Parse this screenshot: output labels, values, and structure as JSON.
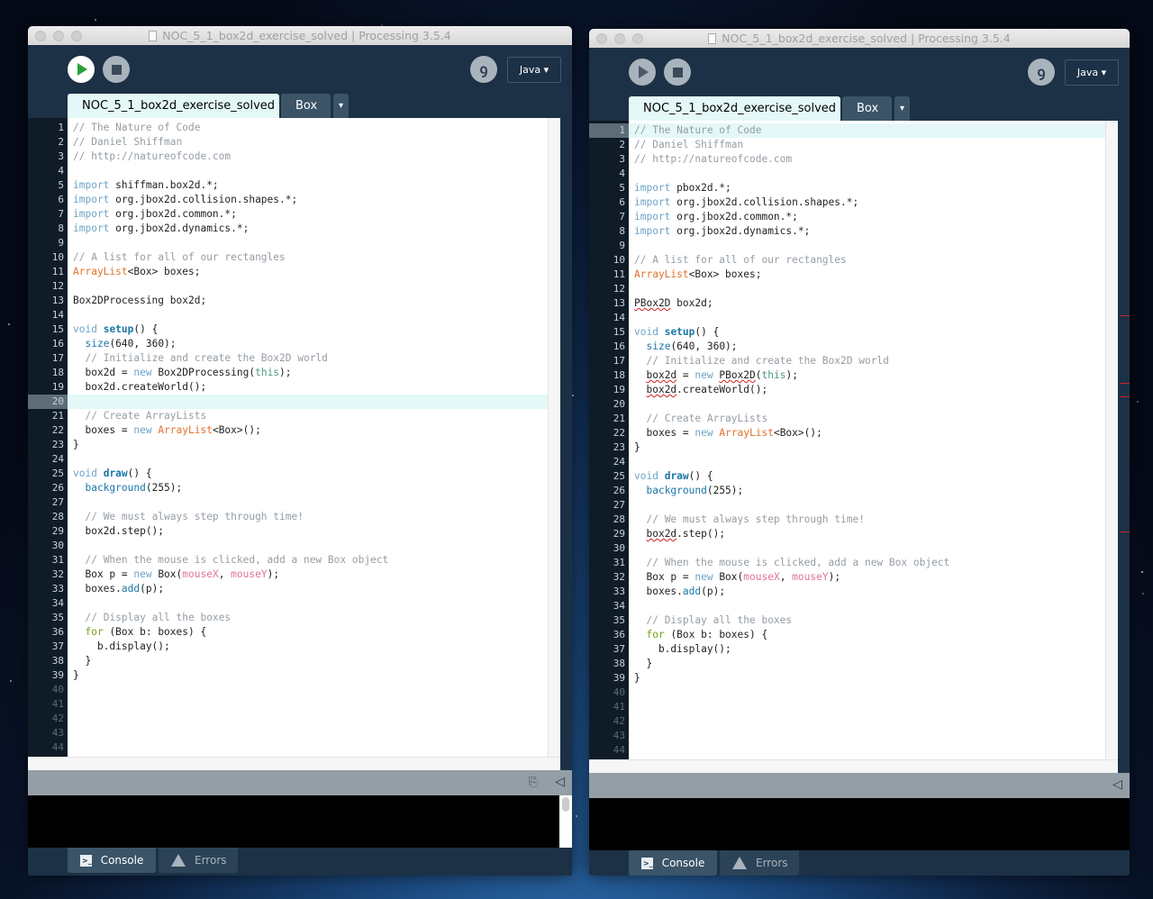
{
  "windows": [
    {
      "title": "NOC_5_1_box2d_exercise_solved | Processing 3.5.4",
      "mode": "Java ▾",
      "run_state": "active",
      "tabs": [
        {
          "label": "NOC_5_1_box2d_exercise_solved"
        },
        {
          "label": "Box"
        }
      ],
      "tab_menu": "▾",
      "highlight_line": 20,
      "console_tab": "Console",
      "errors_tab": "Errors",
      "collapse_icon": "◁",
      "copy_icon": "⎘",
      "code": [
        [
          [
            "c",
            "// The Nature of Code"
          ]
        ],
        [
          [
            "c",
            "// Daniel Shiffman"
          ]
        ],
        [
          [
            "c",
            "// http://natureofcode.com"
          ]
        ],
        [],
        [
          [
            "k",
            "import"
          ],
          [
            "p",
            " shiffman.box2d.*;"
          ]
        ],
        [
          [
            "k",
            "import"
          ],
          [
            "p",
            " org.jbox2d.collision.shapes.*;"
          ]
        ],
        [
          [
            "k",
            "import"
          ],
          [
            "p",
            " org.jbox2d.common.*;"
          ]
        ],
        [
          [
            "k",
            "import"
          ],
          [
            "p",
            " org.jbox2d.dynamics.*;"
          ]
        ],
        [],
        [
          [
            "c",
            "// A list for all of our rectangles"
          ]
        ],
        [
          [
            "t",
            "ArrayList"
          ],
          [
            "p",
            "<Box> boxes;"
          ]
        ],
        [],
        [
          [
            "p",
            "Box2DProcessing box2d;"
          ]
        ],
        [],
        [
          [
            "k",
            "void"
          ],
          [
            "p",
            " "
          ],
          [
            "fb",
            "setup"
          ],
          [
            "p",
            "() {"
          ]
        ],
        [
          [
            "p",
            "  "
          ],
          [
            "f",
            "size"
          ],
          [
            "p",
            "(640, 360);"
          ]
        ],
        [
          [
            "p",
            "  "
          ],
          [
            "c",
            "// Initialize and create the Box2D world"
          ]
        ],
        [
          [
            "p",
            "  box2d = "
          ],
          [
            "k",
            "new"
          ],
          [
            "p",
            " Box2DProcessing("
          ],
          [
            "th",
            "this"
          ],
          [
            "p",
            ");"
          ]
        ],
        [
          [
            "p",
            "  box2d.createWorld();"
          ]
        ],
        [],
        [
          [
            "p",
            "  "
          ],
          [
            "c",
            "// Create ArrayLists"
          ]
        ],
        [
          [
            "p",
            "  boxes = "
          ],
          [
            "k",
            "new"
          ],
          [
            "p",
            " "
          ],
          [
            "t",
            "ArrayList"
          ],
          [
            "p",
            "<Box>();"
          ]
        ],
        [
          [
            "p",
            "}"
          ]
        ],
        [],
        [
          [
            "k",
            "void"
          ],
          [
            "p",
            " "
          ],
          [
            "fb",
            "draw"
          ],
          [
            "p",
            "() {"
          ]
        ],
        [
          [
            "p",
            "  "
          ],
          [
            "f",
            "background"
          ],
          [
            "p",
            "(255);"
          ]
        ],
        [],
        [
          [
            "p",
            "  "
          ],
          [
            "c",
            "// We must always step through time!"
          ]
        ],
        [
          [
            "p",
            "  box2d.step();"
          ]
        ],
        [],
        [
          [
            "p",
            "  "
          ],
          [
            "c",
            "// When the mouse is clicked, add a new Box object"
          ]
        ],
        [
          [
            "p",
            "  Box p = "
          ],
          [
            "k",
            "new"
          ],
          [
            "p",
            " Box("
          ],
          [
            "m",
            "mouseX"
          ],
          [
            "p",
            ", "
          ],
          [
            "m",
            "mouseY"
          ],
          [
            "p",
            ");"
          ]
        ],
        [
          [
            "p",
            "  boxes."
          ],
          [
            "f",
            "add"
          ],
          [
            "p",
            "(p);"
          ]
        ],
        [],
        [
          [
            "p",
            "  "
          ],
          [
            "c",
            "// Display all the boxes"
          ]
        ],
        [
          [
            "p",
            "  "
          ],
          [
            "g",
            "for"
          ],
          [
            "p",
            " (Box b: boxes) {"
          ]
        ],
        [
          [
            "p",
            "    b.display();"
          ]
        ],
        [
          [
            "p",
            "  }"
          ]
        ],
        [
          [
            "p",
            "}"
          ]
        ],
        [],
        [],
        [],
        [],
        []
      ]
    },
    {
      "title": "NOC_5_1_box2d_exercise_solved | Processing 3.5.4",
      "mode": "Java ▾",
      "run_state": "inactive",
      "tabs": [
        {
          "label": "NOC_5_1_box2d_exercise_solved"
        },
        {
          "label": "Box"
        }
      ],
      "tab_menu": "▾",
      "highlight_line": 1,
      "console_tab": "Console",
      "errors_tab": "Errors",
      "collapse_icon": "◁",
      "code": [
        [
          [
            "c",
            "// The Nature of Code"
          ]
        ],
        [
          [
            "c",
            "// Daniel Shiffman"
          ]
        ],
        [
          [
            "c",
            "// http://natureofcode.com"
          ]
        ],
        [],
        [
          [
            "k",
            "import"
          ],
          [
            "p",
            " pbox2d.*;"
          ]
        ],
        [
          [
            "k",
            "import"
          ],
          [
            "p",
            " org.jbox2d.collision.shapes.*;"
          ]
        ],
        [
          [
            "k",
            "import"
          ],
          [
            "p",
            " org.jbox2d.common.*;"
          ]
        ],
        [
          [
            "k",
            "import"
          ],
          [
            "p",
            " org.jbox2d.dynamics.*;"
          ]
        ],
        [],
        [
          [
            "c",
            "// A list for all of our rectangles"
          ]
        ],
        [
          [
            "t",
            "ArrayList"
          ],
          [
            "p",
            "<Box> boxes;"
          ]
        ],
        [],
        [
          [
            "e",
            "PBox2D"
          ],
          [
            "p",
            " box2d;"
          ]
        ],
        [],
        [
          [
            "k",
            "void"
          ],
          [
            "p",
            " "
          ],
          [
            "fb",
            "setup"
          ],
          [
            "p",
            "() {"
          ]
        ],
        [
          [
            "p",
            "  "
          ],
          [
            "f",
            "size"
          ],
          [
            "p",
            "(640, 360);"
          ]
        ],
        [
          [
            "p",
            "  "
          ],
          [
            "c",
            "// Initialize and create the Box2D world"
          ]
        ],
        [
          [
            "p",
            "  "
          ],
          [
            "e",
            "box2d"
          ],
          [
            "p",
            " = "
          ],
          [
            "k",
            "new"
          ],
          [
            "p",
            " "
          ],
          [
            "e",
            "PBox2D"
          ],
          [
            "p",
            "("
          ],
          [
            "th",
            "this"
          ],
          [
            "p",
            ");"
          ]
        ],
        [
          [
            "p",
            "  "
          ],
          [
            "e",
            "box2d"
          ],
          [
            "p",
            ".createWorld();"
          ]
        ],
        [],
        [
          [
            "p",
            "  "
          ],
          [
            "c",
            "// Create ArrayLists"
          ]
        ],
        [
          [
            "p",
            "  boxes = "
          ],
          [
            "k",
            "new"
          ],
          [
            "p",
            " "
          ],
          [
            "t",
            "ArrayList"
          ],
          [
            "p",
            "<Box>();"
          ]
        ],
        [
          [
            "p",
            "}"
          ]
        ],
        [],
        [
          [
            "k",
            "void"
          ],
          [
            "p",
            " "
          ],
          [
            "fb",
            "draw"
          ],
          [
            "p",
            "() {"
          ]
        ],
        [
          [
            "p",
            "  "
          ],
          [
            "f",
            "background"
          ],
          [
            "p",
            "(255);"
          ]
        ],
        [],
        [
          [
            "p",
            "  "
          ],
          [
            "c",
            "// We must always step through time!"
          ]
        ],
        [
          [
            "p",
            "  "
          ],
          [
            "e",
            "box2d"
          ],
          [
            "p",
            ".step();"
          ]
        ],
        [],
        [
          [
            "p",
            "  "
          ],
          [
            "c",
            "// When the mouse is clicked, add a new Box object"
          ]
        ],
        [
          [
            "p",
            "  Box p = "
          ],
          [
            "k",
            "new"
          ],
          [
            "p",
            " Box("
          ],
          [
            "m",
            "mouseX"
          ],
          [
            "p",
            ", "
          ],
          [
            "m",
            "mouseY"
          ],
          [
            "p",
            ");"
          ]
        ],
        [
          [
            "p",
            "  boxes."
          ],
          [
            "f",
            "add"
          ],
          [
            "p",
            "(p);"
          ]
        ],
        [],
        [
          [
            "p",
            "  "
          ],
          [
            "c",
            "// Display all the boxes"
          ]
        ],
        [
          [
            "p",
            "  "
          ],
          [
            "g",
            "for"
          ],
          [
            "p",
            " (Box b: boxes) {"
          ]
        ],
        [
          [
            "p",
            "    b.display();"
          ]
        ],
        [
          [
            "p",
            "  }"
          ]
        ],
        [
          [
            "p",
            "}"
          ]
        ],
        [],
        [],
        [],
        [],
        []
      ]
    }
  ]
}
